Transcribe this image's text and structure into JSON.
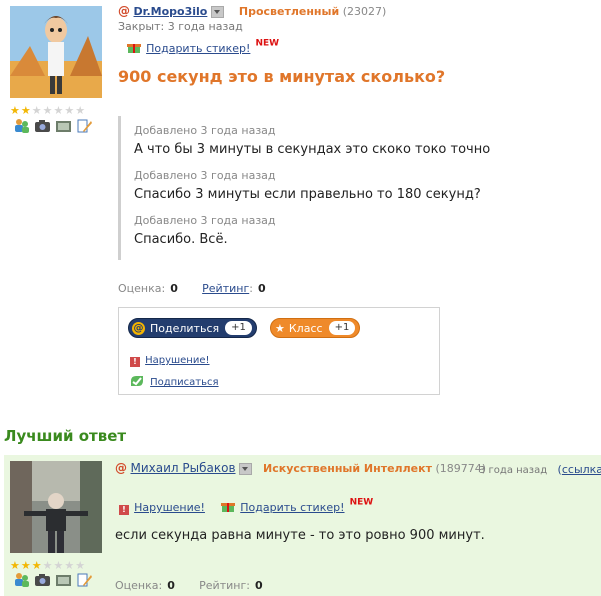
{
  "question": {
    "author": {
      "name": "Dr.Моро3ilo",
      "rank": "Просветленный",
      "points": "(23027)",
      "stars_filled": 2,
      "stars_total": 7
    },
    "status": "Закрыт: 3 года назад",
    "gift_sticker": "Подарить стикер!",
    "new_badge": "NEW",
    "title": "900 секунд это в минутах сколько?",
    "additions": [
      {
        "meta": "Добавлено 3 года назад",
        "text": "А что бы 3 минуты в секундах это скоко токо точно"
      },
      {
        "meta": "Добавлено 3 года назад",
        "text": "Спасибо 3 минуты если правельно то 180 секунд?"
      },
      {
        "meta": "Добавлено 3 года назад",
        "text": "Спасибо. Всё."
      }
    ],
    "score_label": "Оценка:",
    "score_value": "0",
    "rating_label": "Рейтинг",
    "rating_colon": ":",
    "rating_value": "0"
  },
  "share": {
    "share_label": "Поделиться",
    "share_count": "+1",
    "class_label": "Класс",
    "class_count": "+1",
    "report": "Нарушение!",
    "subscribe": "Подписаться"
  },
  "best": {
    "heading": "Лучший ответ",
    "author": {
      "name": "Михаил Рыбаков",
      "rank": "Искусственный Интеллект",
      "points": "(189774)",
      "stars_filled": 3,
      "stars_total": 7
    },
    "time": "3 года назад",
    "link_open": "(",
    "link": "ссылка",
    "link_close": ")",
    "report": "Нарушение!",
    "gift_sticker": "Подарить стикер!",
    "new_badge": "NEW",
    "text": "если секунда равна минуте - то это ровно 900 минут.",
    "score_label": "Оценка:",
    "score_value": "0",
    "rating_label": "Рейтинг:",
    "rating_value": "0"
  },
  "colors": {
    "accent_orange": "#e0762a",
    "link_blue": "#2a4b8d",
    "best_green": "#3a8a1e",
    "best_bg": "#eaf7e0"
  }
}
